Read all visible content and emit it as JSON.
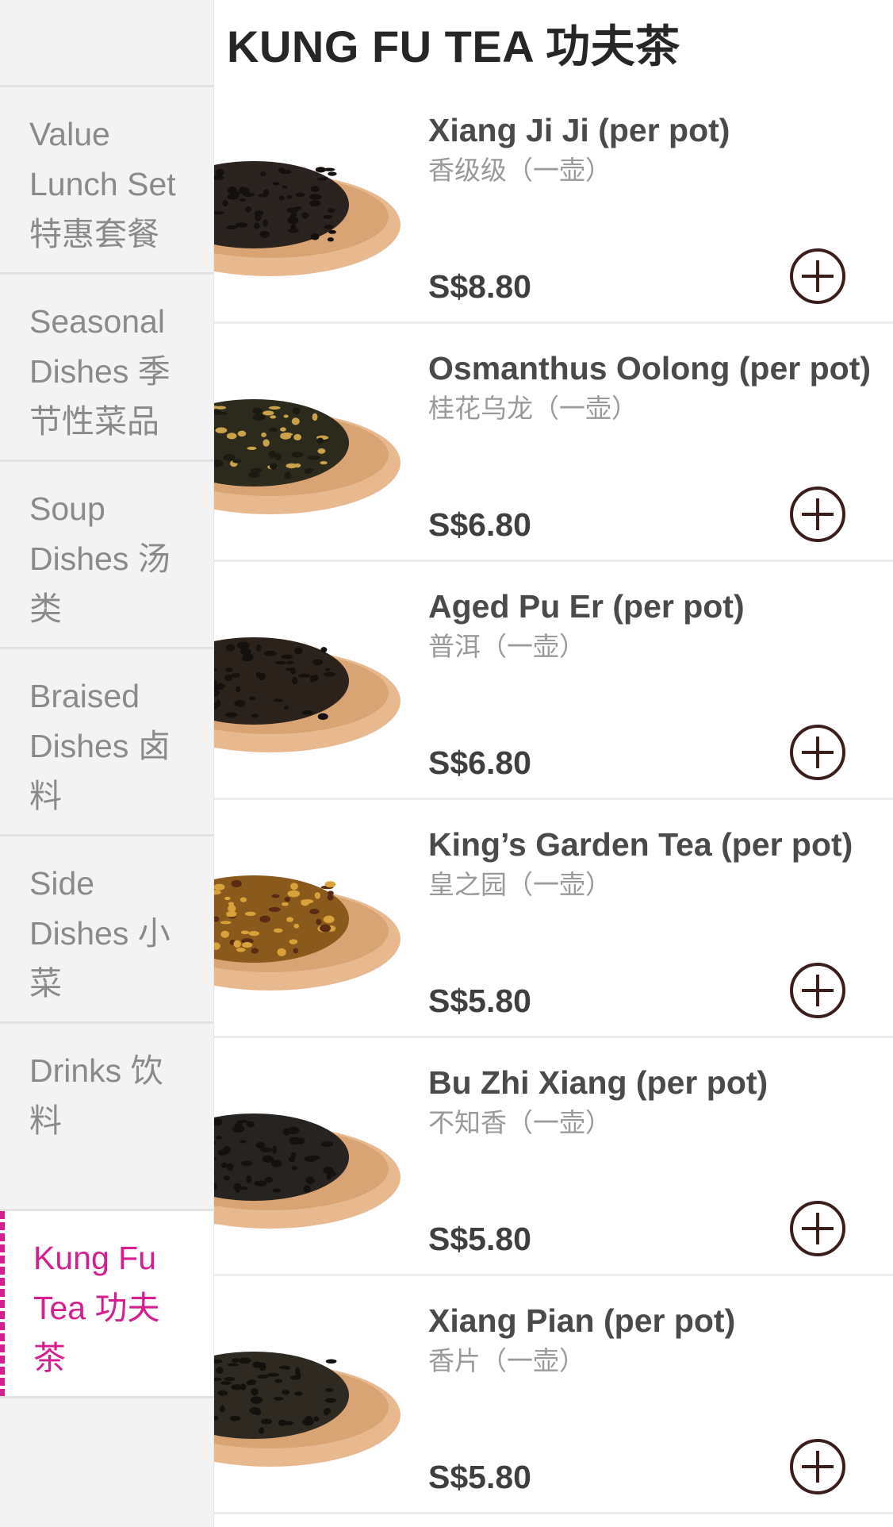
{
  "header": {
    "title": "KUNG FU TEA 功夫茶"
  },
  "sidebar": {
    "categories": [
      {
        "label": "Value Lunch Set 特惠套餐",
        "active": false
      },
      {
        "label": "Seasonal Dishes 季节性菜品",
        "active": false
      },
      {
        "label": "Soup Dishes 汤类",
        "active": false
      },
      {
        "label": "Braised Dishes 卤料",
        "active": false
      },
      {
        "label": "Side Dishes 小菜",
        "active": false
      },
      {
        "label": "Drinks 饮料",
        "active": false
      },
      {
        "label": "Kung Fu Tea 功夫茶",
        "active": true
      }
    ]
  },
  "items": [
    {
      "name": "Xiang Ji Ji (per pot)",
      "sub": "香级级（一壶）",
      "price": "S$8.80",
      "tea_color": "#2a2320"
    },
    {
      "name": "Osmanthus Oolong (per pot)",
      "sub": "桂花乌龙（一壶）",
      "price": "S$6.80",
      "tea_color": "#2b2a1c"
    },
    {
      "name": "Aged Pu Er (per pot)",
      "sub": "普洱（一壶）",
      "price": "S$6.80",
      "tea_color": "#2c221c"
    },
    {
      "name": "King’s Garden Tea (per pot)",
      "sub": "皇之园（一壶）",
      "price": "S$5.80",
      "tea_color": "#8a5a1c"
    },
    {
      "name": "Bu Zhi Xiang (per pot)",
      "sub": "不知香（一壶）",
      "price": "S$5.80",
      "tea_color": "#272320"
    },
    {
      "name": "Xiang Pian (per pot)",
      "sub": "香片（一壶）",
      "price": "S$5.80",
      "tea_color": "#2e2a22"
    }
  ],
  "colors": {
    "accent": "#d61f8e",
    "sidebar_bg": "#f3f3f3",
    "bowl_wood": "#e8b98f"
  },
  "icons": {
    "add": "plus-circle-icon"
  }
}
